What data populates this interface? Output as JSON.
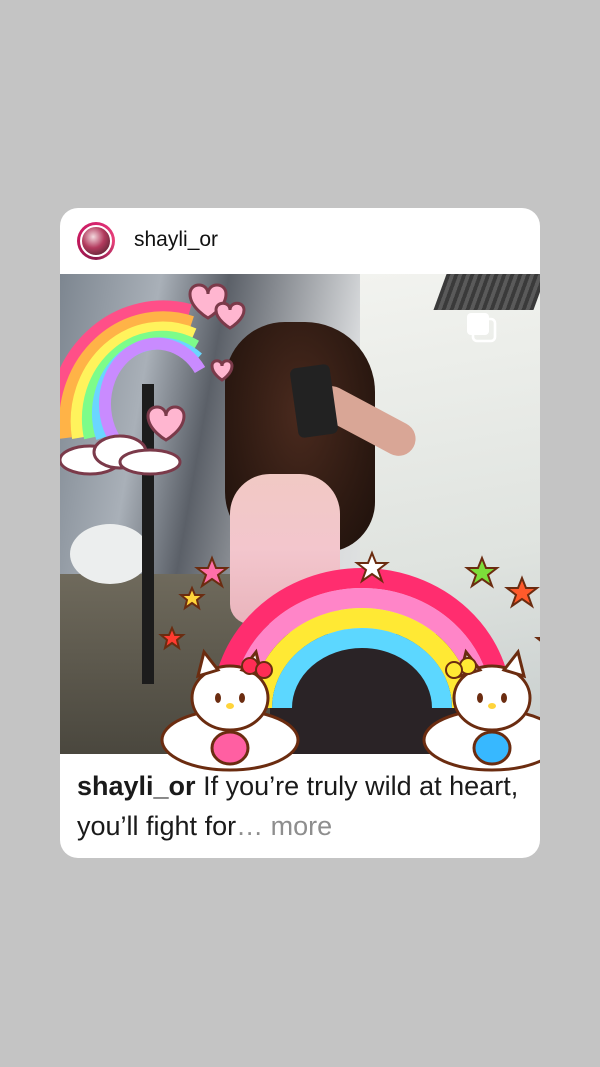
{
  "post": {
    "username": "shayli_or",
    "caption_username": "shayli_or",
    "caption_text": " If you’re truly wild at heart, you’ll fight for",
    "caption_ellipsis": "…",
    "more_label": " more"
  },
  "icons": {
    "avatar": "profile-avatar",
    "multi": "multiple-photos-icon"
  },
  "colors": {
    "background": "#c4c4c4",
    "card": "#ffffff",
    "more": "#8e8e8e"
  }
}
